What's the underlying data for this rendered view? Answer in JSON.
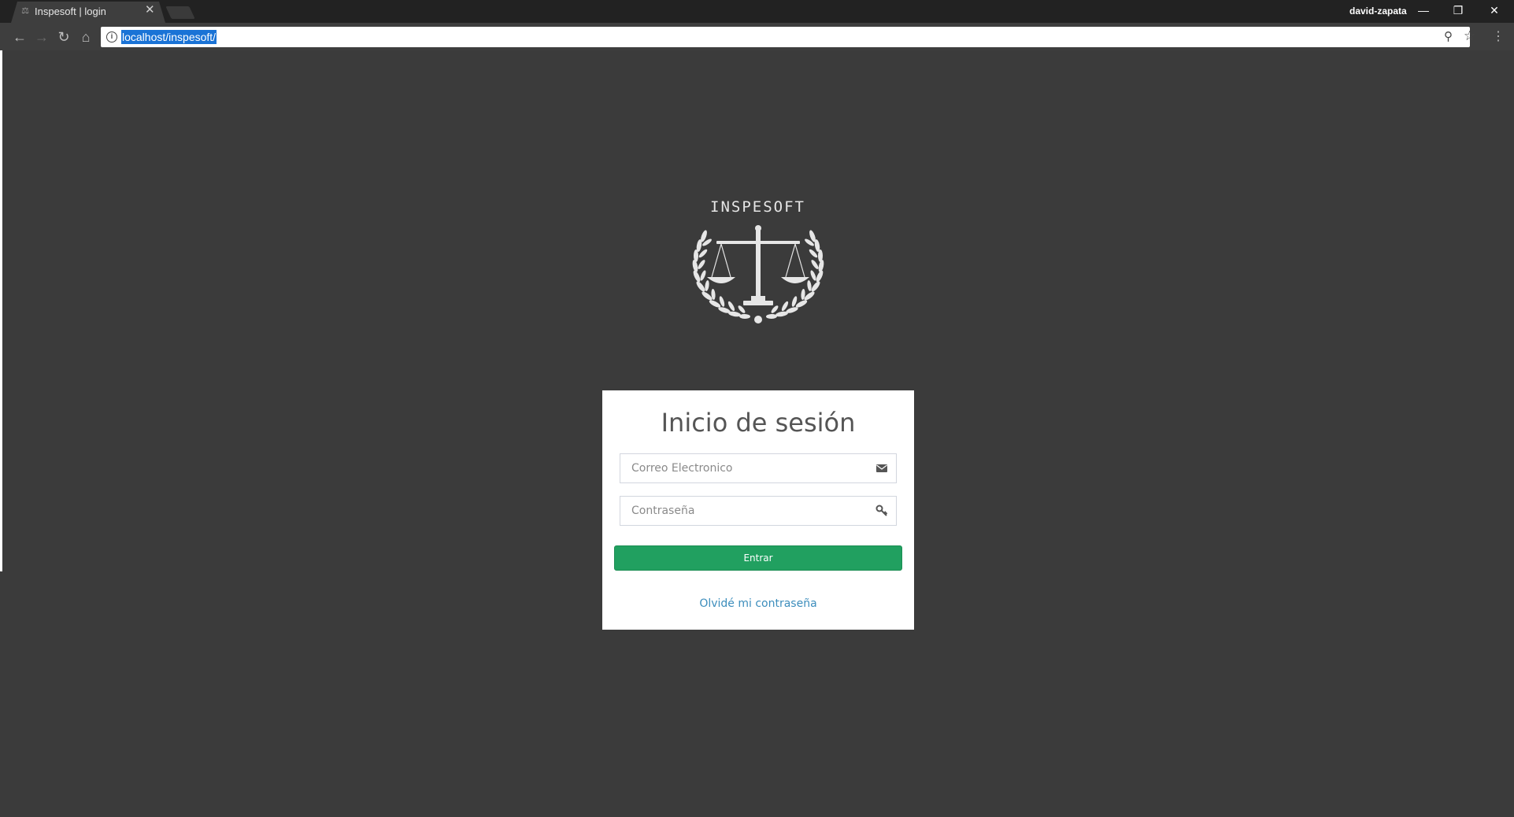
{
  "browser": {
    "tab_title": "Inspesoft | login",
    "tab_close": "✕",
    "user": "david-zapata",
    "url": "localhost/inspesoft/"
  },
  "logo": {
    "title": "INSPESOFT",
    "icon": "scales-of-justice-laurel-icon"
  },
  "login": {
    "title": "Inicio de sesión",
    "email_placeholder": "Correo Electronico",
    "password_placeholder": "Contraseña",
    "submit_label": "Entrar",
    "forgot_label": "Olvidé mi contraseña"
  },
  "colors": {
    "page_bg": "#3b3b3b",
    "button": "#21a060",
    "link": "#3c8dbc"
  }
}
